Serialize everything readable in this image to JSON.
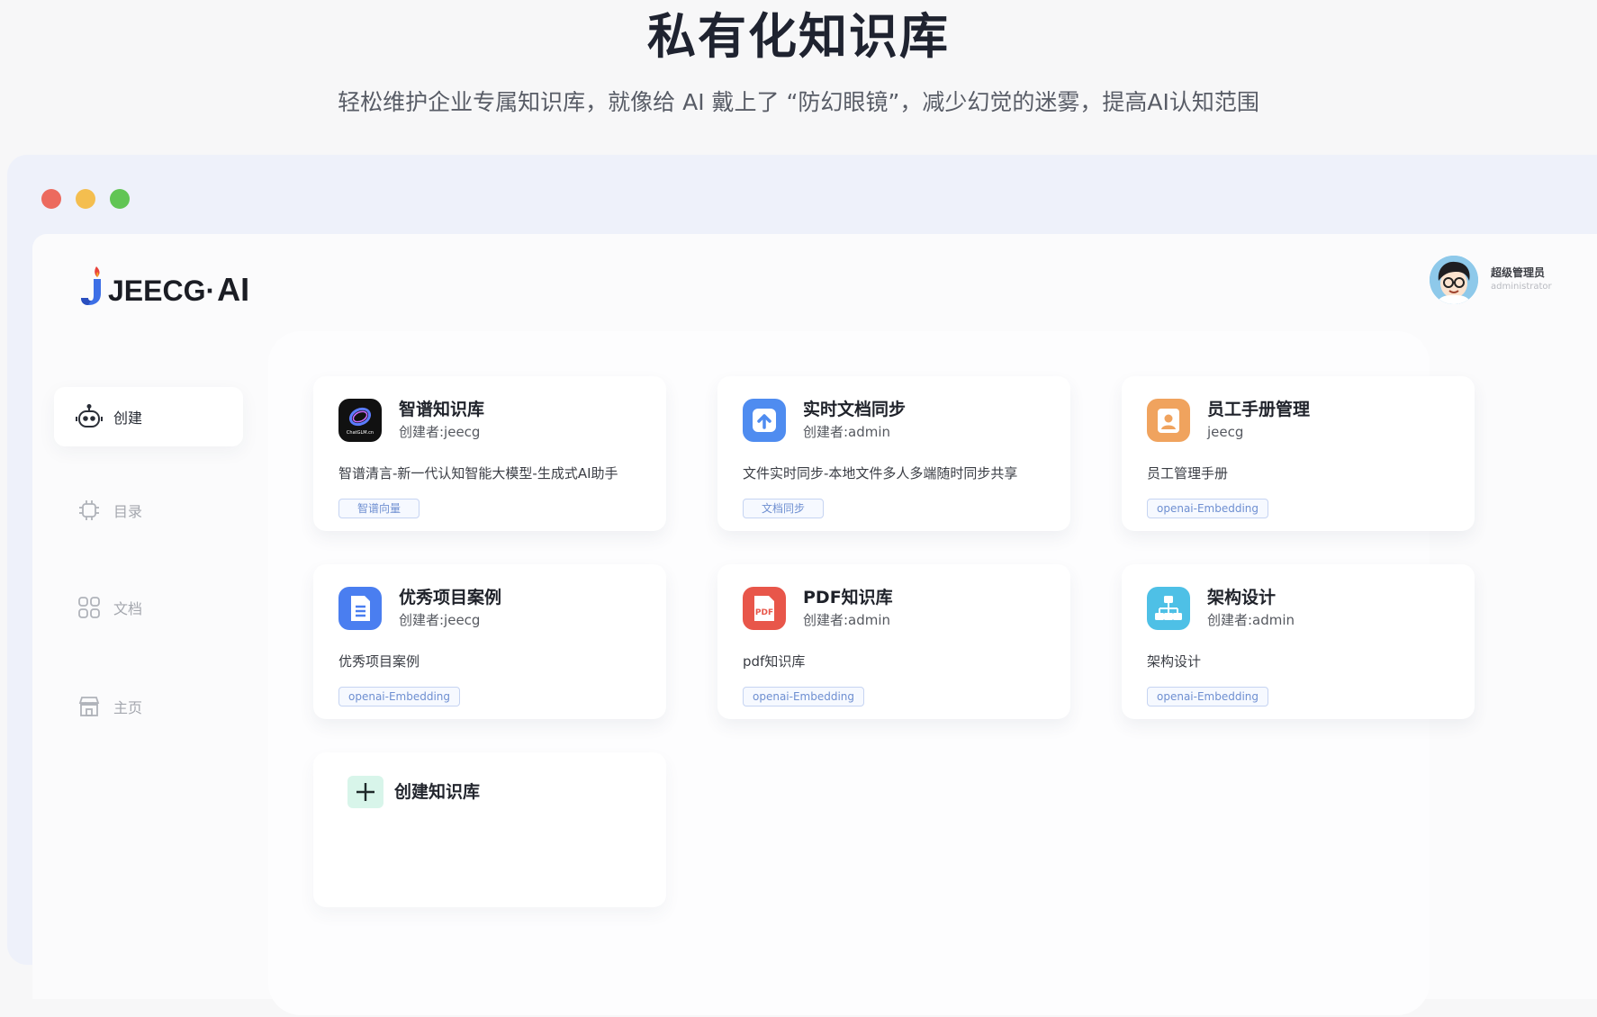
{
  "hero": {
    "title": "私有化知识库",
    "subtitle": "轻松维护企业专属知识库，就像给 AI 戴上了 “防幻眼镜”，减少幻觉的迷雾，提高AI认知范围"
  },
  "app": {
    "logo_text": "JEECG·",
    "logo_ai": "AI",
    "user": {
      "name": "超级管理员",
      "role": "administrator"
    }
  },
  "sidebar": {
    "items": [
      {
        "label": "创建",
        "icon": "robot-icon",
        "active": true
      },
      {
        "label": "目录",
        "icon": "chip-icon",
        "active": false
      },
      {
        "label": "文档",
        "icon": "grid-icon",
        "active": false
      },
      {
        "label": "主页",
        "icon": "store-icon",
        "active": false
      }
    ]
  },
  "cards": [
    {
      "title": "智谱知识库",
      "creator": "创建者:jeecg",
      "description": "智谱清言-新一代认知智能大模型-生成式AI助手",
      "tag": "智谱向量",
      "icon": "chatglm-icon",
      "icon_label": "ChatGLM.cn",
      "color": "#111111"
    },
    {
      "title": "实时文档同步",
      "creator": "创建者:admin",
      "description": "文件实时同步-本地文件多人多端随时同步共享",
      "tag": "文档同步",
      "icon": "sync-upload-icon",
      "color": "#4f8cf0"
    },
    {
      "title": "员工手册管理",
      "creator": "jeecg",
      "description": "员工管理手册",
      "tag": "openai-Embedding",
      "icon": "employee-badge-icon",
      "color": "#f0a35e"
    },
    {
      "title": "优秀项目案例",
      "creator": "创建者:jeecg",
      "description": "优秀项目案例",
      "tag": "openai-Embedding",
      "icon": "document-list-icon",
      "color": "#4a7ef0"
    },
    {
      "title": "PDF知识库",
      "creator": "创建者:admin",
      "description": "pdf知识库",
      "tag": "openai-Embedding",
      "icon": "pdf-icon",
      "icon_label": "PDF",
      "color": "#e8564a"
    },
    {
      "title": "架构设计",
      "creator": "创建者:admin",
      "description": "架构设计",
      "tag": "openai-Embedding",
      "icon": "org-chart-icon",
      "color": "#4ec0e6"
    }
  ],
  "create_card": {
    "label": "创建知识库",
    "icon": "plus-icon"
  }
}
